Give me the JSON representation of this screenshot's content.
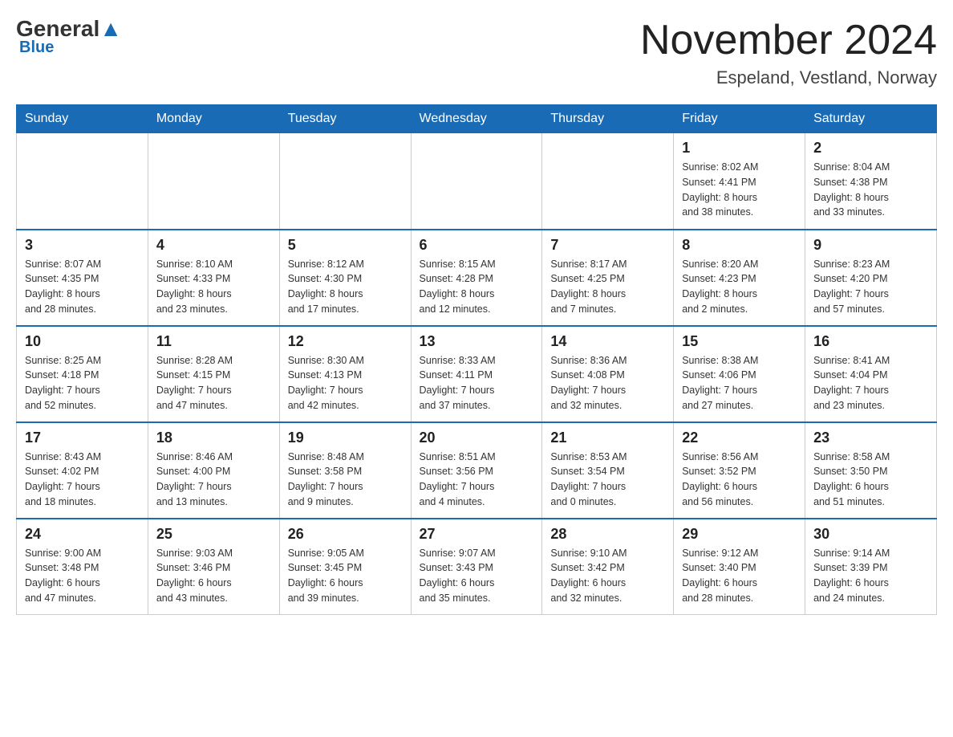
{
  "header": {
    "logo_main": "General",
    "logo_sub": "Blue",
    "title": "November 2024",
    "location": "Espeland, Vestland, Norway"
  },
  "days_of_week": [
    "Sunday",
    "Monday",
    "Tuesday",
    "Wednesday",
    "Thursday",
    "Friday",
    "Saturday"
  ],
  "weeks": [
    {
      "days": [
        {
          "number": "",
          "info": ""
        },
        {
          "number": "",
          "info": ""
        },
        {
          "number": "",
          "info": ""
        },
        {
          "number": "",
          "info": ""
        },
        {
          "number": "",
          "info": ""
        },
        {
          "number": "1",
          "info": "Sunrise: 8:02 AM\nSunset: 4:41 PM\nDaylight: 8 hours\nand 38 minutes."
        },
        {
          "number": "2",
          "info": "Sunrise: 8:04 AM\nSunset: 4:38 PM\nDaylight: 8 hours\nand 33 minutes."
        }
      ]
    },
    {
      "days": [
        {
          "number": "3",
          "info": "Sunrise: 8:07 AM\nSunset: 4:35 PM\nDaylight: 8 hours\nand 28 minutes."
        },
        {
          "number": "4",
          "info": "Sunrise: 8:10 AM\nSunset: 4:33 PM\nDaylight: 8 hours\nand 23 minutes."
        },
        {
          "number": "5",
          "info": "Sunrise: 8:12 AM\nSunset: 4:30 PM\nDaylight: 8 hours\nand 17 minutes."
        },
        {
          "number": "6",
          "info": "Sunrise: 8:15 AM\nSunset: 4:28 PM\nDaylight: 8 hours\nand 12 minutes."
        },
        {
          "number": "7",
          "info": "Sunrise: 8:17 AM\nSunset: 4:25 PM\nDaylight: 8 hours\nand 7 minutes."
        },
        {
          "number": "8",
          "info": "Sunrise: 8:20 AM\nSunset: 4:23 PM\nDaylight: 8 hours\nand 2 minutes."
        },
        {
          "number": "9",
          "info": "Sunrise: 8:23 AM\nSunset: 4:20 PM\nDaylight: 7 hours\nand 57 minutes."
        }
      ]
    },
    {
      "days": [
        {
          "number": "10",
          "info": "Sunrise: 8:25 AM\nSunset: 4:18 PM\nDaylight: 7 hours\nand 52 minutes."
        },
        {
          "number": "11",
          "info": "Sunrise: 8:28 AM\nSunset: 4:15 PM\nDaylight: 7 hours\nand 47 minutes."
        },
        {
          "number": "12",
          "info": "Sunrise: 8:30 AM\nSunset: 4:13 PM\nDaylight: 7 hours\nand 42 minutes."
        },
        {
          "number": "13",
          "info": "Sunrise: 8:33 AM\nSunset: 4:11 PM\nDaylight: 7 hours\nand 37 minutes."
        },
        {
          "number": "14",
          "info": "Sunrise: 8:36 AM\nSunset: 4:08 PM\nDaylight: 7 hours\nand 32 minutes."
        },
        {
          "number": "15",
          "info": "Sunrise: 8:38 AM\nSunset: 4:06 PM\nDaylight: 7 hours\nand 27 minutes."
        },
        {
          "number": "16",
          "info": "Sunrise: 8:41 AM\nSunset: 4:04 PM\nDaylight: 7 hours\nand 23 minutes."
        }
      ]
    },
    {
      "days": [
        {
          "number": "17",
          "info": "Sunrise: 8:43 AM\nSunset: 4:02 PM\nDaylight: 7 hours\nand 18 minutes."
        },
        {
          "number": "18",
          "info": "Sunrise: 8:46 AM\nSunset: 4:00 PM\nDaylight: 7 hours\nand 13 minutes."
        },
        {
          "number": "19",
          "info": "Sunrise: 8:48 AM\nSunset: 3:58 PM\nDaylight: 7 hours\nand 9 minutes."
        },
        {
          "number": "20",
          "info": "Sunrise: 8:51 AM\nSunset: 3:56 PM\nDaylight: 7 hours\nand 4 minutes."
        },
        {
          "number": "21",
          "info": "Sunrise: 8:53 AM\nSunset: 3:54 PM\nDaylight: 7 hours\nand 0 minutes."
        },
        {
          "number": "22",
          "info": "Sunrise: 8:56 AM\nSunset: 3:52 PM\nDaylight: 6 hours\nand 56 minutes."
        },
        {
          "number": "23",
          "info": "Sunrise: 8:58 AM\nSunset: 3:50 PM\nDaylight: 6 hours\nand 51 minutes."
        }
      ]
    },
    {
      "days": [
        {
          "number": "24",
          "info": "Sunrise: 9:00 AM\nSunset: 3:48 PM\nDaylight: 6 hours\nand 47 minutes."
        },
        {
          "number": "25",
          "info": "Sunrise: 9:03 AM\nSunset: 3:46 PM\nDaylight: 6 hours\nand 43 minutes."
        },
        {
          "number": "26",
          "info": "Sunrise: 9:05 AM\nSunset: 3:45 PM\nDaylight: 6 hours\nand 39 minutes."
        },
        {
          "number": "27",
          "info": "Sunrise: 9:07 AM\nSunset: 3:43 PM\nDaylight: 6 hours\nand 35 minutes."
        },
        {
          "number": "28",
          "info": "Sunrise: 9:10 AM\nSunset: 3:42 PM\nDaylight: 6 hours\nand 32 minutes."
        },
        {
          "number": "29",
          "info": "Sunrise: 9:12 AM\nSunset: 3:40 PM\nDaylight: 6 hours\nand 28 minutes."
        },
        {
          "number": "30",
          "info": "Sunrise: 9:14 AM\nSunset: 3:39 PM\nDaylight: 6 hours\nand 24 minutes."
        }
      ]
    }
  ]
}
